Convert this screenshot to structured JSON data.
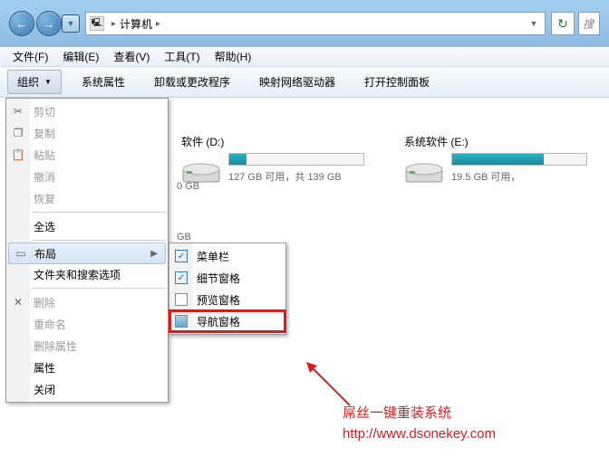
{
  "titlebar": {
    "back_icon": "←",
    "fwd_icon": "→",
    "location_icon": "🖳",
    "location": "计算机",
    "sep": "▸",
    "refresh_icon": "↻",
    "search_placeholder": "搜"
  },
  "menubar": {
    "file": "文件(F)",
    "edit": "编辑(E)",
    "view": "查看(V)",
    "tools": "工具(T)",
    "help": "帮助(H)"
  },
  "toolbar": {
    "organize": "组织",
    "sysprops": "系统属性",
    "uninstall": "卸载或更改程序",
    "mapdrive": "映射网络驱动器",
    "controlpanel": "打开控制面板"
  },
  "dropdown": {
    "cut": "剪切",
    "copy": "复制",
    "paste": "粘贴",
    "undo": "撤消",
    "redo": "恢复",
    "selectall": "全选",
    "layout": "布局",
    "folderoptions": "文件夹和搜索选项",
    "delete": "删除",
    "rename": "重命名",
    "removeprops": "删除属性",
    "properties": "属性",
    "close": "关闭",
    "cut_icon": "✂",
    "copy_icon": "❐",
    "paste_icon": "📋",
    "layout_icon": "▭",
    "delete_icon": "✕"
  },
  "submenu": {
    "menubar": "菜单栏",
    "details": "细节窗格",
    "preview": "预览窗格",
    "navigation": "导航窗格"
  },
  "drives": {
    "d_name": "软件 (D:)",
    "d_text": "127 GB 可用，共 139 GB",
    "d_fill": "13%",
    "e_name": "系统软件 (E:)",
    "e_text": "19.5 GB 可用，",
    "e_fill": "68%",
    "leftover_gb": "0 GB",
    "leftover_gb2": "GB"
  },
  "annotation": {
    "line1": "屌丝一键重装系统",
    "line2": "http://www.dsonekey.com"
  }
}
